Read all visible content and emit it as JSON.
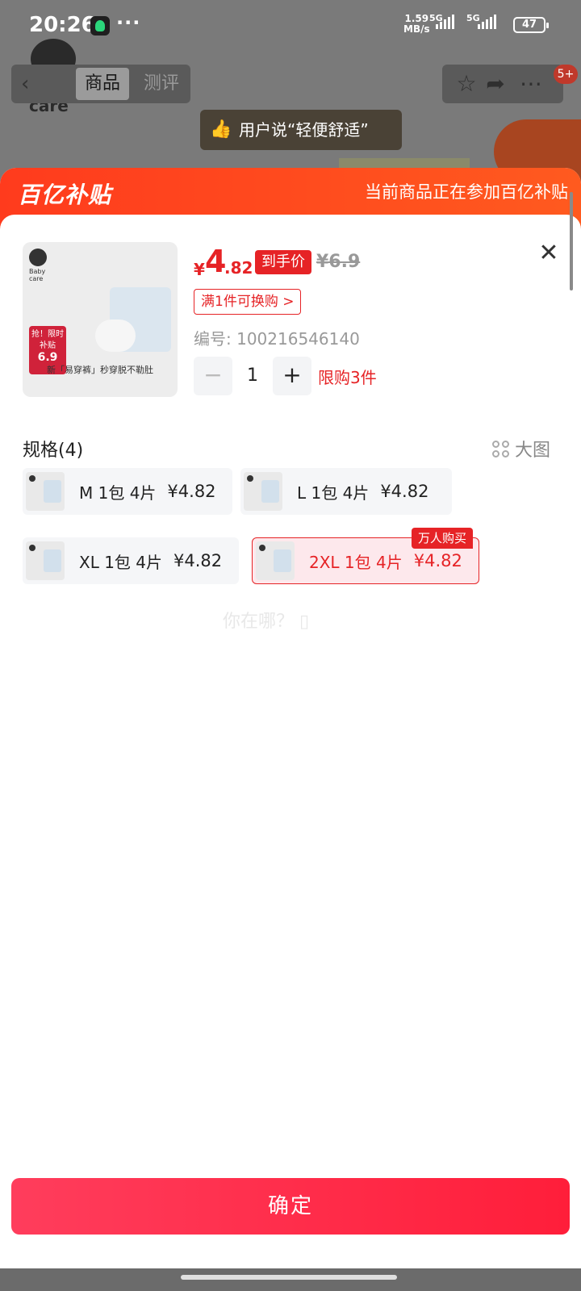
{
  "status_bar": {
    "time": "20:26",
    "dots": "···",
    "speed": "1.59",
    "speed_unit": "MB/s",
    "sig1": "5G",
    "sig2": "5G",
    "battery": "47"
  },
  "background": {
    "logo": "Baby\ncare",
    "tab_active": "商品",
    "tab_other": "测评",
    "badge": "5+",
    "pill": "用户说“轻便舒适”"
  },
  "sheet": {
    "brand": "百亿补贴",
    "notice": "当前商品正在参加百亿补贴",
    "image_tag_top": "抢！限时补贴",
    "image_tag_price": "6.9",
    "image_caption": "新「易穿裤」秒穿脱不勒肚",
    "price": {
      "currency": "¥",
      "integer": "4",
      "decimal": ".82",
      "tag": "到手价",
      "original": "¥6.9"
    },
    "promo": "满1件可换购 >",
    "sku_no": "编号: 100216546140",
    "quantity": "1",
    "limit": "限购3件",
    "spec_title": "规格(4)",
    "big_image": "大图",
    "specs": [
      {
        "label": "M 1包 4片",
        "price": "¥4.82",
        "selected": false
      },
      {
        "label": "L 1包 4片",
        "price": "¥4.82",
        "selected": false
      },
      {
        "label": "XL 1包 4片",
        "price": "¥4.82",
        "selected": false
      },
      {
        "label": "2XL 1包 4片",
        "price": "¥4.82",
        "selected": true,
        "tag": "万人购买"
      }
    ],
    "watermark": "你在哪？ ▯",
    "confirm": "确定"
  },
  "colors": {
    "accent": "#e62326",
    "banner": "#ff4a1f",
    "confirm": "#ff2947"
  }
}
